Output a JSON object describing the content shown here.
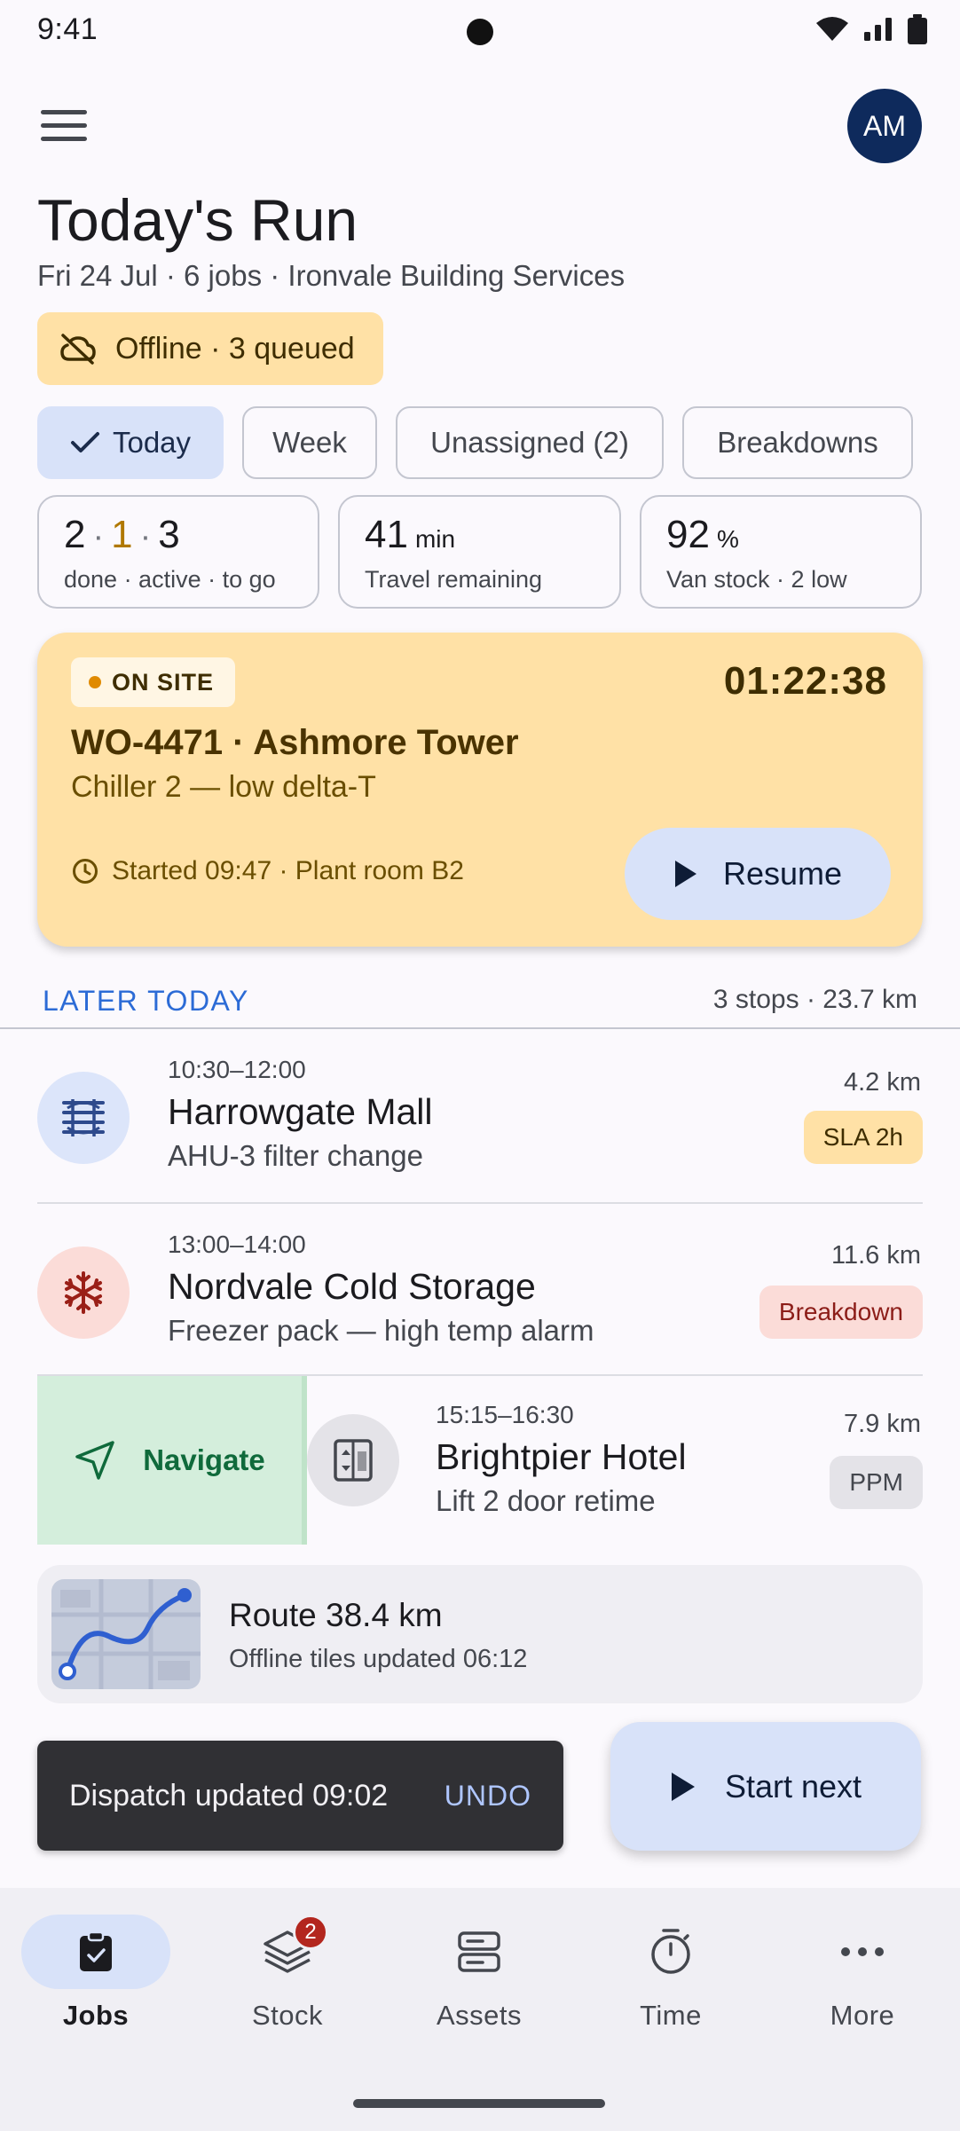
{
  "status_bar": {
    "time": "9:41"
  },
  "header": {
    "avatar_initials": "AM",
    "title": "Today's Run",
    "subtitle": "Fri 24 Jul · 6 jobs · Ironvale Building Services"
  },
  "offline_banner": {
    "text": "Offline · 3 queued",
    "icon": "cloud-off-icon"
  },
  "filters": [
    {
      "label": "Today",
      "selected": true
    },
    {
      "label": "Week",
      "selected": false
    },
    {
      "label": "Unassigned (2)",
      "selected": false
    },
    {
      "label": "Breakdowns",
      "selected": false
    }
  ],
  "stats": {
    "progress": {
      "done": "2",
      "active": "1",
      "to_go": "3",
      "sep": "·",
      "label": "done · active · to go"
    },
    "travel": {
      "value": "41",
      "unit": "min",
      "label": "Travel remaining"
    },
    "stock": {
      "value": "92",
      "unit": "%",
      "label": "Van stock · 2 low"
    }
  },
  "on_site": {
    "badge": "ON SITE",
    "timer": "01:22:38",
    "title": "WO-4471 · Ashmore Tower",
    "subtitle": "Chiller 2 — low delta-T",
    "meta": "Started 09:47 · Plant room B2",
    "resume_label": "Resume",
    "colors": {
      "card": "#FFE1A6",
      "dot": "#E08A00"
    }
  },
  "later": {
    "label": "LATER TODAY",
    "meta": "3 stops · 23.7 km",
    "jobs": [
      {
        "time": "10:30–12:00",
        "name": "Harrowgate Mall",
        "desc": "AHU-3 filter change",
        "distance": "4.2 km",
        "badge": "SLA 2h",
        "icon": "air-filter-icon"
      },
      {
        "time": "13:00–14:00",
        "name": "Nordvale Cold Storage",
        "desc": "Freezer pack — high temp alarm",
        "distance": "11.6 km",
        "badge": "Breakdown",
        "icon": "snowflake-icon"
      },
      {
        "time": "15:15–16:30",
        "name": "Brightpier Hotel",
        "desc": "Lift 2 door retime",
        "distance": "7.9 km",
        "badge": "PPM",
        "icon": "elevator-icon",
        "swipe_action": "Navigate"
      }
    ]
  },
  "route": {
    "title": "Route 38.4 km",
    "subtitle": "Offline tiles updated 06:12"
  },
  "snackbar": {
    "text": "Dispatch updated 09:02",
    "action": "UNDO"
  },
  "fab": {
    "label": "Start next"
  },
  "bottom_nav": [
    {
      "label": "Jobs",
      "icon": "clipboard-icon",
      "active": true
    },
    {
      "label": "Stock",
      "icon": "layers-icon",
      "badge": "2"
    },
    {
      "label": "Assets",
      "icon": "server-icon"
    },
    {
      "label": "Time",
      "icon": "stopwatch-icon"
    },
    {
      "label": "More",
      "icon": "more-horizontal-icon"
    }
  ]
}
